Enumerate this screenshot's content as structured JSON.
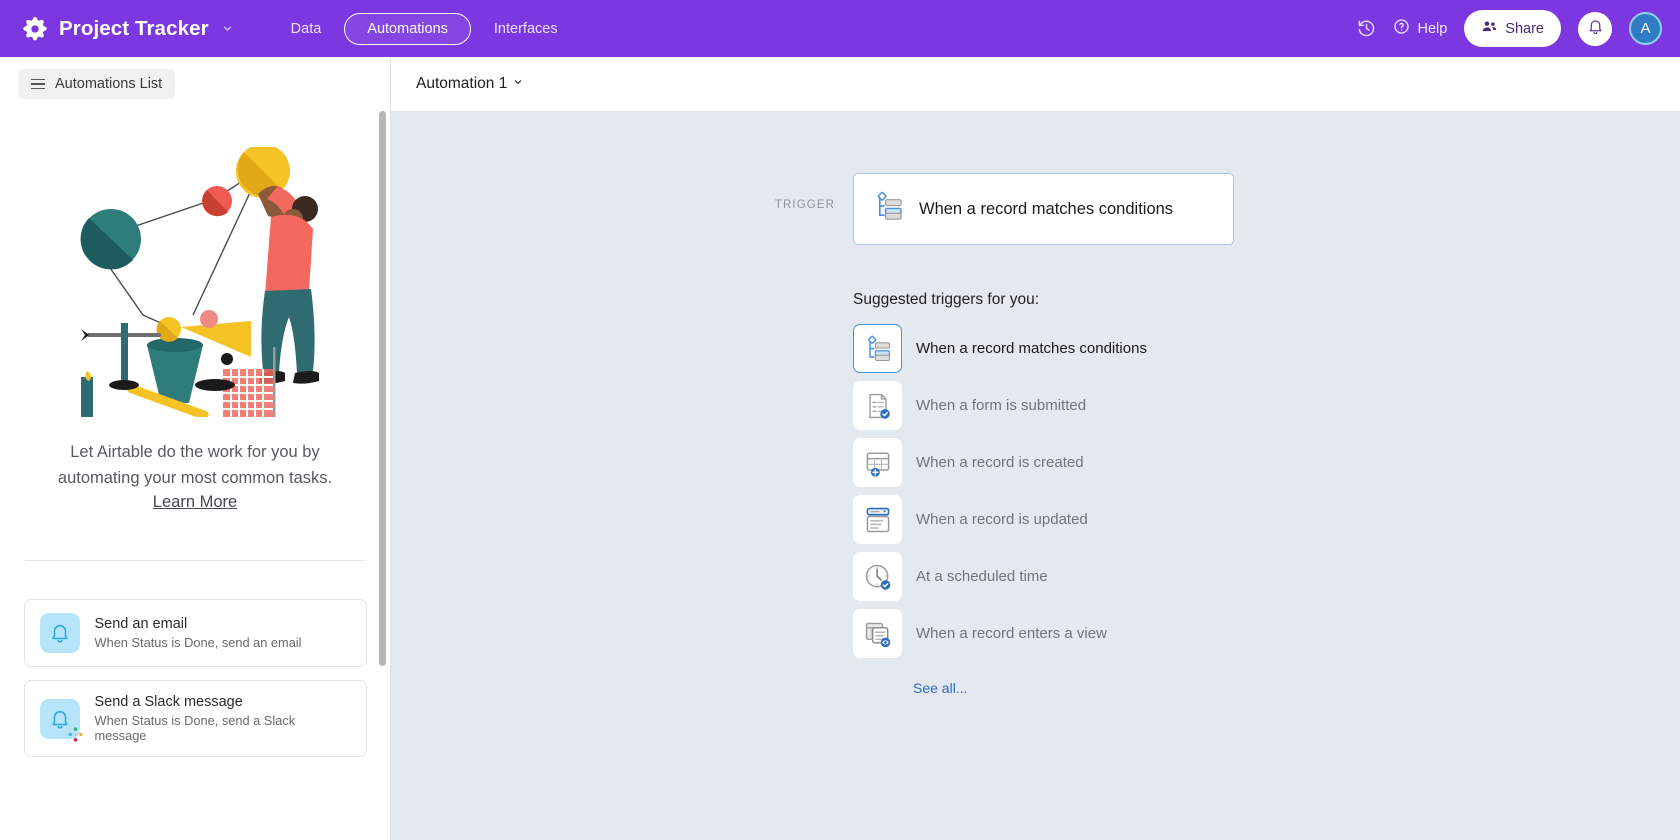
{
  "header": {
    "app_icon": "airtable-blocks-icon",
    "base_name": "Project Tracker",
    "base_caret": "chevron-down-icon",
    "nav": [
      {
        "label": "Data",
        "active": false
      },
      {
        "label": "Automations",
        "active": true
      },
      {
        "label": "Interfaces",
        "active": false
      }
    ],
    "history_icon": "history-icon",
    "help_label": "Help",
    "help_icon": "question-circle-icon",
    "share_label": "Share",
    "share_icon": "people-icon",
    "bell_icon": "bell-icon",
    "avatar_initial": "A",
    "purple": "#7c37e0",
    "avatar_color": "#2f7cc4"
  },
  "toolbar": {
    "automations_list_label": "Automations List",
    "menu_icon": "hamburger-icon",
    "automation_name": "Automation 1",
    "automation_caret": "chevron-down-icon"
  },
  "sidebar": {
    "illustration": "rube-goldberg-illustration",
    "blurb": "Let Airtable do the work for you by automating your most common tasks.",
    "learn_more_label": "Learn More",
    "templates": [
      {
        "title": "Send an email",
        "subtitle": "When Status is Done, send an email",
        "icon": "bell-icon",
        "badge": null
      },
      {
        "title": "Send a Slack message",
        "subtitle": "When Status is Done, send a Slack message",
        "icon": "bell-icon",
        "badge": "slack-icon"
      }
    ]
  },
  "canvas": {
    "trigger_section_label": "TRIGGER",
    "trigger_card": {
      "label": "When a record matches conditions",
      "icon": "record-matches-conditions-icon",
      "border_color": "#a9c4e8"
    },
    "suggested_heading": "Suggested triggers for you:",
    "suggested_triggers": [
      {
        "label": "When a record matches conditions",
        "icon": "record-matches-conditions-icon",
        "selected": true
      },
      {
        "label": "When a form is submitted",
        "icon": "form-submitted-icon",
        "selected": false
      },
      {
        "label": "When a record is created",
        "icon": "record-created-icon",
        "selected": false
      },
      {
        "label": "When a record is updated",
        "icon": "record-updated-icon",
        "selected": false
      },
      {
        "label": "At a scheduled time",
        "icon": "clock-icon",
        "selected": false
      },
      {
        "label": "When a record enters a view",
        "icon": "record-enters-view-icon",
        "selected": false
      }
    ],
    "see_all_label": "See all...",
    "background": "#e4e8ef",
    "link_color": "#2b6cc4"
  }
}
